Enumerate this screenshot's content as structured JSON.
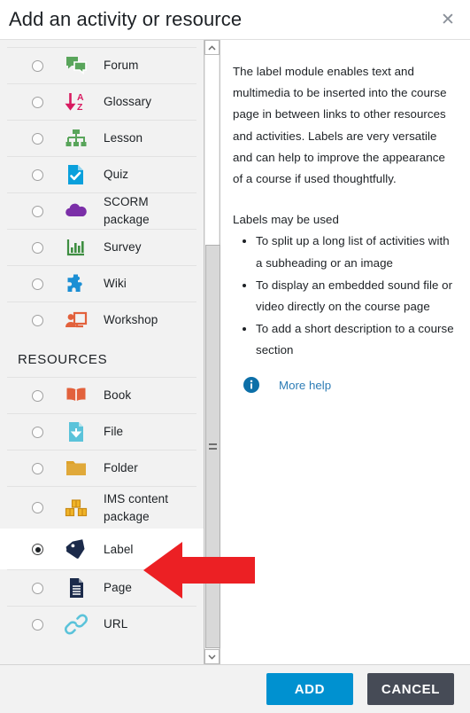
{
  "header": {
    "title": "Add an activity or resource",
    "close_label": "✕"
  },
  "chooser": {
    "activities": [
      {
        "label": "Forum",
        "icon": "forum-icon",
        "selected": false
      },
      {
        "label": "Glossary",
        "icon": "glossary-icon",
        "selected": false
      },
      {
        "label": "Lesson",
        "icon": "lesson-icon",
        "selected": false
      },
      {
        "label": "Quiz",
        "icon": "quiz-icon",
        "selected": false
      },
      {
        "label": "SCORM package",
        "icon": "scorm-icon",
        "selected": false
      },
      {
        "label": "Survey",
        "icon": "survey-icon",
        "selected": false
      },
      {
        "label": "Wiki",
        "icon": "wiki-icon",
        "selected": false
      },
      {
        "label": "Workshop",
        "icon": "workshop-icon",
        "selected": false
      }
    ],
    "resources_heading": "RESOURCES",
    "resources": [
      {
        "label": "Book",
        "icon": "book-icon",
        "selected": false
      },
      {
        "label": "File",
        "icon": "file-icon",
        "selected": false
      },
      {
        "label": "Folder",
        "icon": "folder-icon",
        "selected": false
      },
      {
        "label": "IMS content package",
        "icon": "ims-icon",
        "selected": false
      },
      {
        "label": "Label",
        "icon": "label-icon",
        "selected": true
      },
      {
        "label": "Page",
        "icon": "page-icon",
        "selected": false
      },
      {
        "label": "URL",
        "icon": "url-icon",
        "selected": false
      }
    ]
  },
  "description": {
    "paragraph1": "The label module enables text and multimedia to be inserted into the course page in between links to other resources and activities. Labels are very versatile and can help to improve the appearance of a course if used thoughtfully.",
    "paragraph2": "Labels may be used",
    "bullets": [
      "To split up a long list of activities with a subheading or an image",
      "To display an embedded sound file or video directly on the course page",
      "To add a short description to a course section"
    ],
    "more_help_label": "More help"
  },
  "footer": {
    "add_label": "ADD",
    "cancel_label": "CANCEL"
  },
  "annotation": {
    "arrow": "red-left-arrow pointing at Label row"
  },
  "colors": {
    "accent_blue": "#0091d0",
    "cancel_dark": "#464b56",
    "link_blue": "#2e7db6",
    "arrow_red": "#ec2024",
    "panel_bg": "#f2f2f2"
  }
}
